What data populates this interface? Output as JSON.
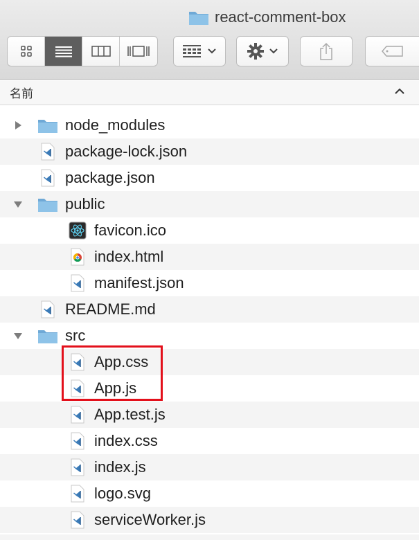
{
  "window": {
    "title": "react-comment-box"
  },
  "toolbar": {
    "view_buttons": [
      "icon-view-icon",
      "list-view-icon",
      "column-view-icon",
      "gallery-view-icon"
    ],
    "active_view": "list-view-icon"
  },
  "header": {
    "column_name": "名前",
    "sort": "ascending"
  },
  "files": [
    {
      "name": "node_modules",
      "kind": "folder",
      "expanded": false,
      "level": 0
    },
    {
      "name": "package-lock.json",
      "kind": "vscode",
      "level": 0
    },
    {
      "name": "package.json",
      "kind": "vscode",
      "level": 0
    },
    {
      "name": "public",
      "kind": "folder",
      "expanded": true,
      "level": 0
    },
    {
      "name": "favicon.ico",
      "kind": "react",
      "level": 1
    },
    {
      "name": "index.html",
      "kind": "chrome",
      "level": 1
    },
    {
      "name": "manifest.json",
      "kind": "vscode",
      "level": 1
    },
    {
      "name": "README.md",
      "kind": "vscode",
      "level": 0
    },
    {
      "name": "src",
      "kind": "folder",
      "expanded": true,
      "level": 0
    },
    {
      "name": "App.css",
      "kind": "vscode",
      "level": 1
    },
    {
      "name": "App.js",
      "kind": "vscode",
      "level": 1
    },
    {
      "name": "App.test.js",
      "kind": "vscode",
      "level": 1
    },
    {
      "name": "index.css",
      "kind": "vscode",
      "level": 1
    },
    {
      "name": "index.js",
      "kind": "vscode",
      "level": 1
    },
    {
      "name": "logo.svg",
      "kind": "vscode",
      "level": 1
    },
    {
      "name": "serviceWorker.js",
      "kind": "vscode",
      "level": 1
    }
  ],
  "highlight": {
    "color": "#e3101b",
    "items": [
      "App.css",
      "App.js"
    ]
  },
  "colors": {
    "folder": "#8ec3e8",
    "vscode": "#3b7bb8"
  }
}
